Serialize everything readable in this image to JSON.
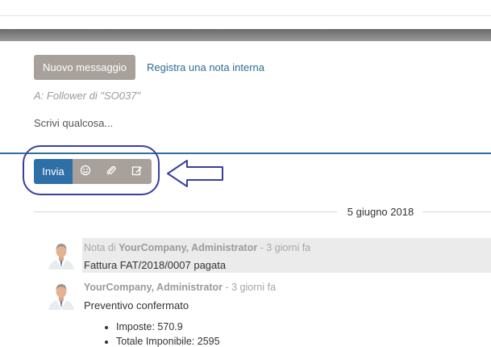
{
  "composer": {
    "new_message_label": "Nuovo messaggio",
    "internal_note_link": "Registra una nota interna",
    "recipients": "A: Follower di \"SO037\"",
    "placeholder": "Scrivi qualcosa...",
    "send_label": "Invia",
    "tools": [
      {
        "icon": "emoji-icon"
      },
      {
        "icon": "paperclip-icon"
      },
      {
        "icon": "full-composer-icon"
      }
    ]
  },
  "thread": {
    "date_separator": "5 giugno 2018",
    "messages": [
      {
        "prefix": "Nota di ",
        "author": "YourCompany, Administrator",
        "time": " - 3 giorni fa",
        "body": "Fattura FAT/2018/0007 pagata",
        "highlighted": true
      },
      {
        "prefix": "",
        "author": "YourCompany, Administrator",
        "time": " - 3 giorni fa",
        "body": "Preventivo confermato",
        "highlighted": false,
        "bullets": [
          "Imposte: 570.9",
          "Totale Imponibile: 2595"
        ]
      }
    ]
  },
  "colors": {
    "primary": "#2f6fa8",
    "secondary_button": "#a8a19b",
    "annotation": "#3a3f9f",
    "note_background": "#ebebeb"
  }
}
